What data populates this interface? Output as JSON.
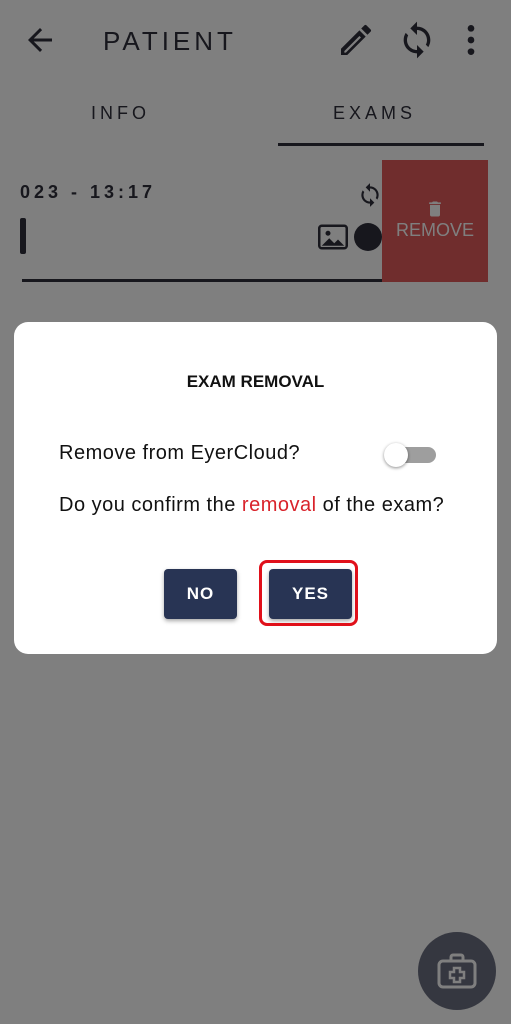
{
  "header": {
    "title": "PATIENT",
    "back_icon": "arrow-left-icon",
    "edit_icon": "pencil-icon",
    "sync_icon": "sync-icon",
    "menu_icon": "more-vert-icon"
  },
  "tabs": [
    {
      "label": "INFO",
      "active": false
    },
    {
      "label": "EXAMS",
      "active": true
    }
  ],
  "exam": {
    "date_text": "023 - 13:17",
    "remove_label": "REMOVE",
    "remove_icon": "trash-icon",
    "sync_icon": "sync-icon",
    "image_icon": "image-icon"
  },
  "dialog": {
    "title": "EXAM REMOVAL",
    "toggle_label": "Remove from EyerCloud?",
    "toggle_on": false,
    "confirm_before": "Do you confirm the ",
    "confirm_highlight": "removal",
    "confirm_after": " of the exam?",
    "no_label": "NO",
    "yes_label": "YES"
  },
  "fab": {
    "icon": "medical-kit-icon"
  },
  "colors": {
    "primary": "#283454",
    "danger": "#e15a5a",
    "highlight_red": "#d9232b",
    "callout": "#e0101a"
  }
}
